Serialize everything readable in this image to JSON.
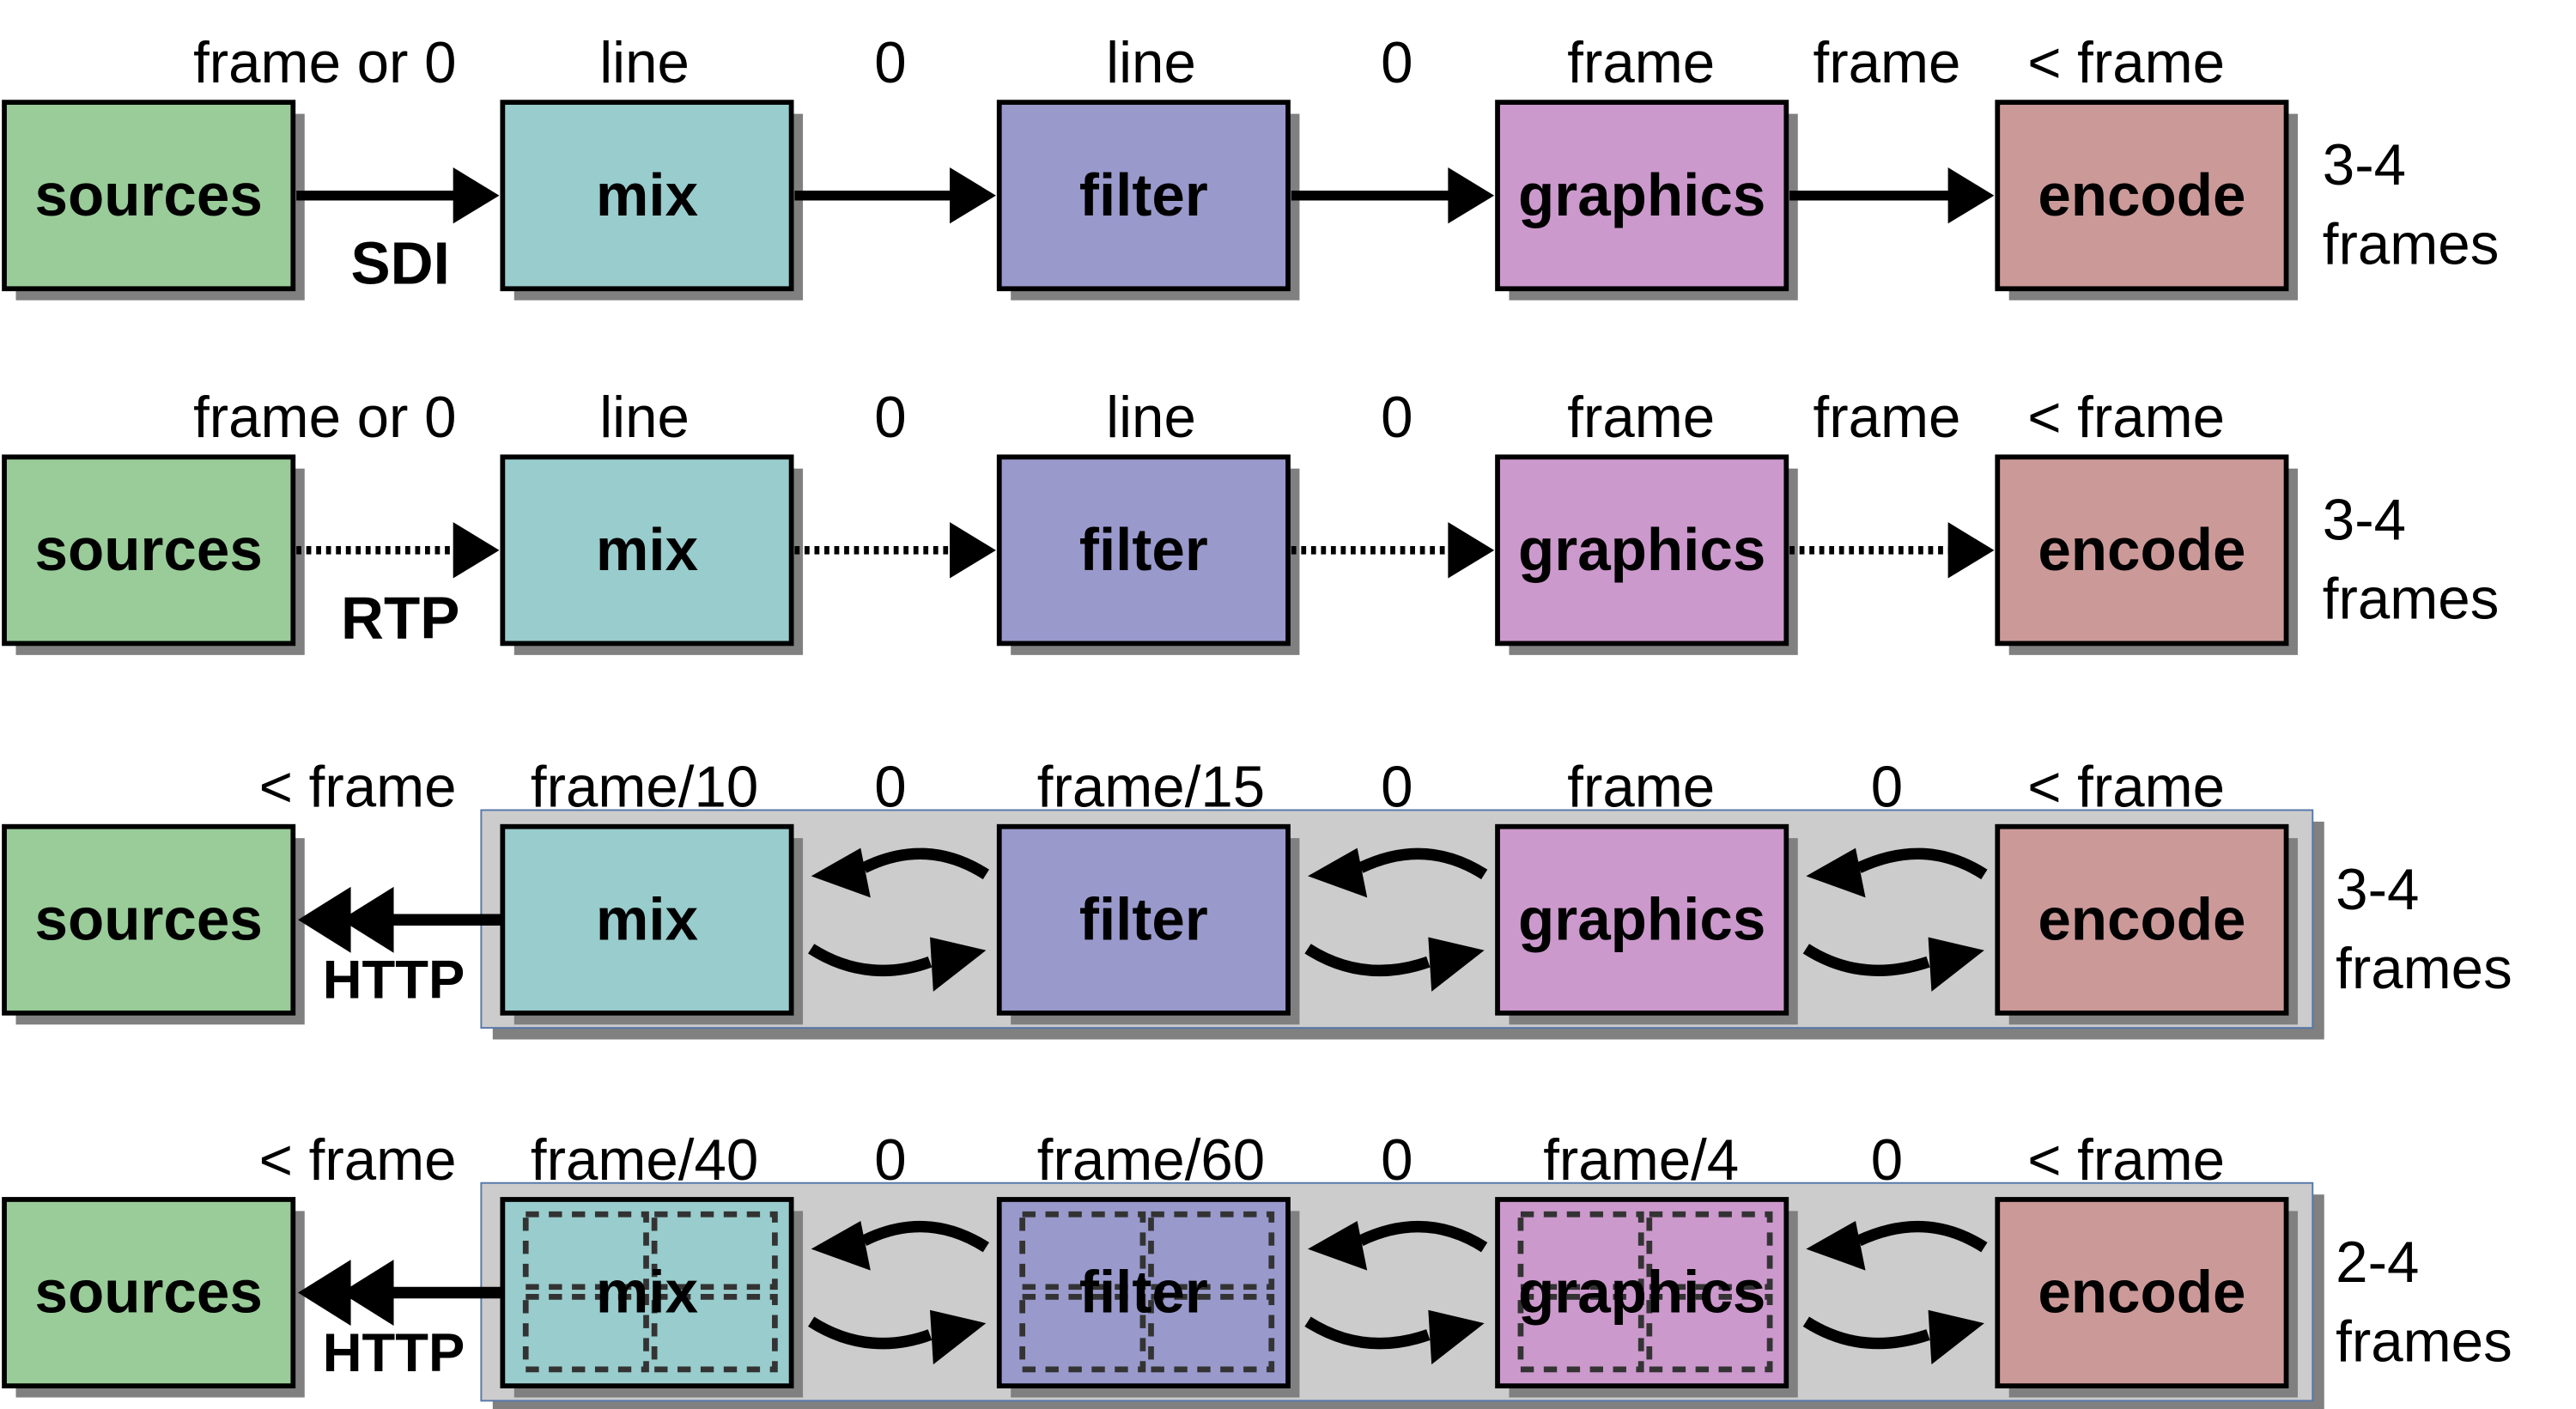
{
  "stages": [
    "sources",
    "mix",
    "filter",
    "graphics",
    "encode"
  ],
  "colors": {
    "sources": "#99CC99",
    "mix": "#99CCCC",
    "filter": "#9999CC",
    "graphics": "#CC99CC",
    "encode": "#CC9999",
    "panel": "#CCCCCC",
    "shadow": "#808080"
  },
  "rows": [
    {
      "protocol": "SDI",
      "link_style": "solid",
      "direction": "push",
      "labels": [
        "frame or 0",
        "line",
        "0",
        "line",
        "0",
        "frame",
        "frame",
        "< frame"
      ],
      "latency": [
        "3-4",
        "frames"
      ],
      "tiled": false
    },
    {
      "protocol": "RTP",
      "link_style": "dotted",
      "direction": "push",
      "labels": [
        "frame or 0",
        "line",
        "0",
        "line",
        "0",
        "frame",
        "frame",
        "< frame"
      ],
      "latency": [
        "3-4",
        "frames"
      ],
      "tiled": false
    },
    {
      "protocol": "HTTP",
      "link_style": "request-response",
      "direction": "pull",
      "labels": [
        "< frame",
        "frame/10",
        "0",
        "frame/15",
        "0",
        "frame",
        "0",
        "< frame"
      ],
      "latency": [
        "3-4",
        "frames"
      ],
      "tiled": false
    },
    {
      "protocol": "HTTP",
      "link_style": "request-response",
      "direction": "pull",
      "labels": [
        "< frame",
        "frame/40",
        "0",
        "frame/60",
        "0",
        "frame/4",
        "0",
        "< frame"
      ],
      "latency": [
        "2-4",
        "frames"
      ],
      "tiled": true
    }
  ]
}
